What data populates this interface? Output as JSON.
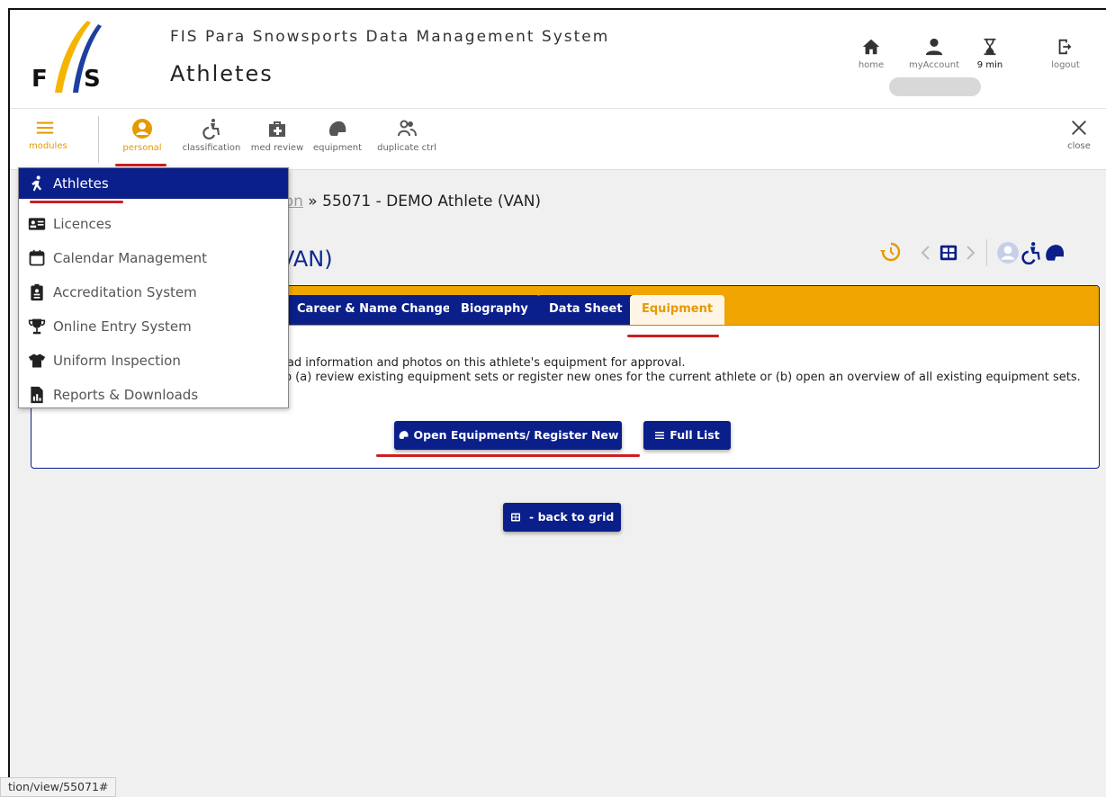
{
  "header": {
    "system_title": "FIS Para Snowsports Data Management System",
    "page_heading": "Athletes",
    "tools": {
      "home": "home",
      "my_account": "myAccount",
      "timer": "9 min",
      "logout": "logout"
    }
  },
  "toolbar": {
    "modules": "modules",
    "personal": "personal",
    "classification": "classification",
    "med_review": "med review",
    "equipment": "equipment",
    "duplicate_ctrl": "duplicate ctrl",
    "close": "close"
  },
  "breadcrumb": {
    "link": "ion",
    "separator": " » ",
    "current": "55071 - DEMO Athlete (VAN)"
  },
  "athlete_title": "VAN)",
  "tabs": [
    "Career & Name Changes",
    "Biography",
    "Data Sheet",
    "Equipment"
  ],
  "panel": {
    "line1": "oad information and photos on this athlete's equipment for approval.",
    "line2": "to (a) review existing equipment sets or register new ones for the current athlete or (b) open an overview of all existing equipment sets.",
    "open_button": "Open Equipments/ Register New",
    "full_list_button": "Full List"
  },
  "back_button": " - back to grid",
  "menu": {
    "items": [
      {
        "label": "Athletes",
        "icon": "athlete-icon"
      },
      {
        "label": "Licences",
        "icon": "id-card-icon"
      },
      {
        "label": "Calendar Management",
        "icon": "calendar-icon"
      },
      {
        "label": "Accreditation System",
        "icon": "badge-icon"
      },
      {
        "label": "Online Entry System",
        "icon": "trophy-icon"
      },
      {
        "label": "Uniform Inspection",
        "icon": "shirt-icon"
      },
      {
        "label": "Reports & Downloads",
        "icon": "report-icon"
      }
    ]
  },
  "status_url": "tion/view/55071#",
  "colors": {
    "navy": "#0a1f8a",
    "orange": "#f0a500",
    "highlight_red": "#cc1f1f"
  }
}
